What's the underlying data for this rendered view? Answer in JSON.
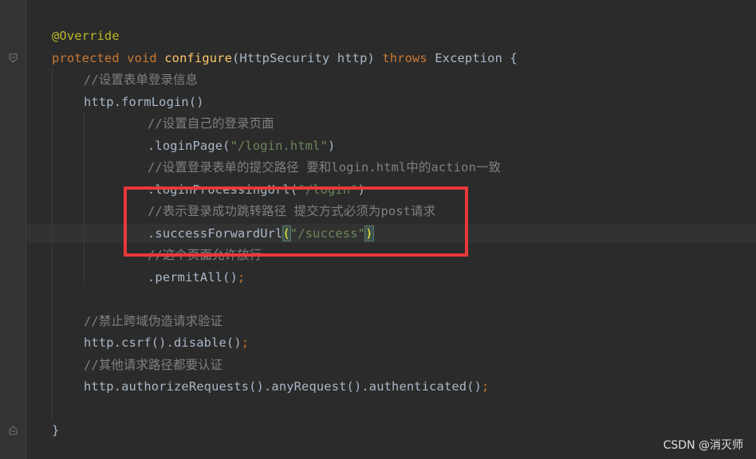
{
  "code": {
    "override": "@Override",
    "sig": {
      "protected": "protected",
      "void": "void",
      "name": "configure",
      "params": "(HttpSecurity http) ",
      "throws": "throws",
      "rest": " Exception {"
    },
    "c1": "//设置表单登录信息",
    "formLogin": "http.formLogin()",
    "c2": "//设置自己的登录页面",
    "loginPage": {
      "method": ".loginPage(",
      "arg": "\"/login.html\"",
      "close": ")"
    },
    "c3": "//设置登录表单的提交路径 要和login.html中的action一致",
    "loginProcessing": {
      "method": ".loginProcessingUrl(",
      "arg": "\"/login\"",
      "close": ")"
    },
    "c4": "//表示登录成功跳转路径 提交方式必须为post请求",
    "successForward": {
      "method": ".successForwardUrl",
      "open": "(",
      "arg": "\"/success\"",
      "close": ")"
    },
    "c5": "//这个页面允许放行",
    "permitAll": {
      "method": ".permitAll()",
      "semi": ";"
    },
    "c6": "//禁止跨域伪造请求验证",
    "csrf": {
      "method": "http.csrf().disable()",
      "semi": ";"
    },
    "c7": "//其他请求路径都要认证",
    "authorize": {
      "method": "http.authorizeRequests().anyRequest().authenticated()",
      "semi": ";"
    },
    "closing": "}"
  },
  "watermark": "CSDN @消灭师",
  "colors": {
    "highlight_box": "#e8393a",
    "keyword": "#cc7832",
    "string": "#6a8759",
    "comment": "#808080",
    "function": "#ffc66d",
    "annotation": "#bbb529"
  }
}
